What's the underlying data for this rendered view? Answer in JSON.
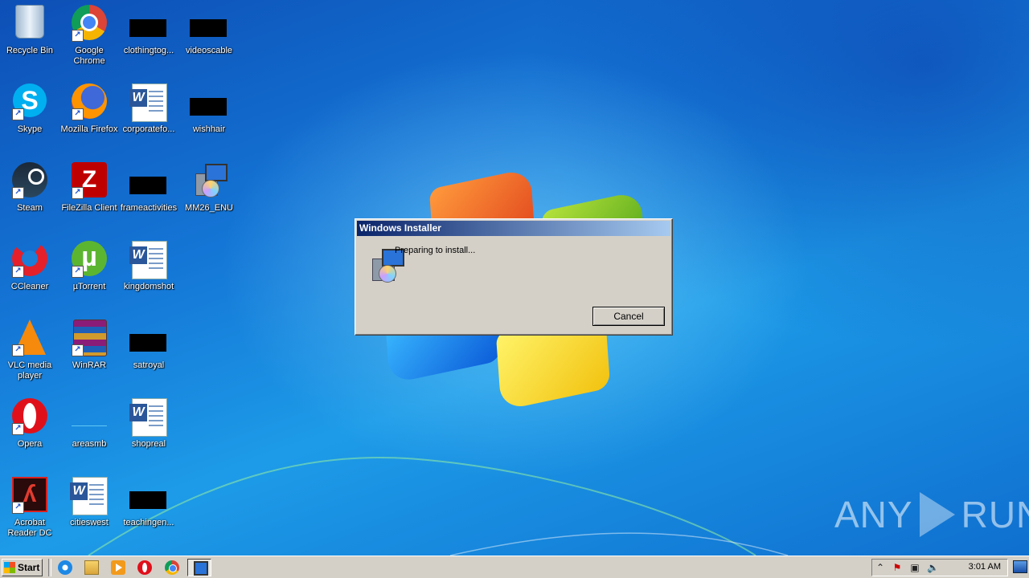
{
  "desktop": {
    "icons": [
      {
        "label": "Recycle Bin"
      },
      {
        "label": "Google Chrome"
      },
      {
        "label": "clothingtog..."
      },
      {
        "label": "videoscable"
      },
      {
        "label": "Skype"
      },
      {
        "label": "Mozilla Firefox"
      },
      {
        "label": "corporatefo..."
      },
      {
        "label": "wishhair"
      },
      {
        "label": "Steam"
      },
      {
        "label": "FileZilla Client"
      },
      {
        "label": "frameactivities"
      },
      {
        "label": "MM26_ENU"
      },
      {
        "label": "CCleaner"
      },
      {
        "label": "µTorrent"
      },
      {
        "label": "kingdomshot"
      },
      {
        "label": "VLC media player"
      },
      {
        "label": "WinRAR"
      },
      {
        "label": "satroyal"
      },
      {
        "label": "Opera"
      },
      {
        "label": "areasmb"
      },
      {
        "label": "shopreal"
      },
      {
        "label": "Acrobat Reader DC"
      },
      {
        "label": "citieswest"
      },
      {
        "label": "teachingen..."
      }
    ]
  },
  "dialog": {
    "title": "Windows Installer",
    "message": "Preparing to install...",
    "cancel_label": "Cancel"
  },
  "watermark": {
    "left": "ANY",
    "right": "RUN"
  },
  "taskbar": {
    "start_label": "Start",
    "clock": "3:01 AM"
  },
  "colors": {
    "title_bar_start": "#0a246a",
    "title_bar_end": "#a6caf0",
    "dialog_face": "#d4d0c8"
  }
}
